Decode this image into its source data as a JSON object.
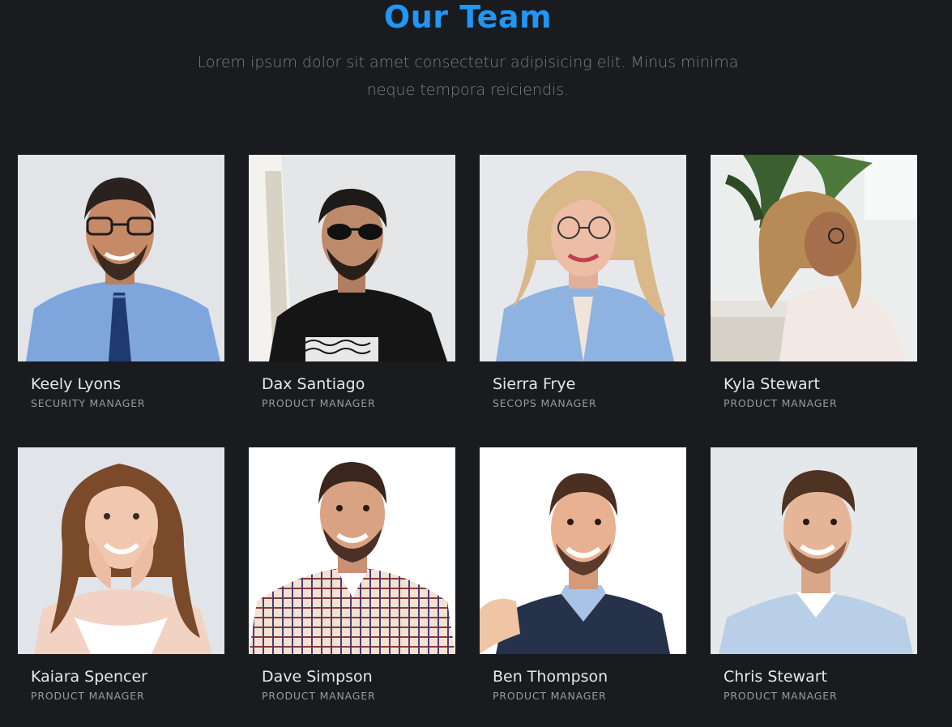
{
  "section": {
    "title": "Our Team",
    "subtitle": "Lorem ipsum dolor sit amet consectetur adipisicing elit. Minus minima neque tempora reiciendis."
  },
  "members": [
    {
      "name": "Keely Lyons",
      "role": "SECURITY MANAGER"
    },
    {
      "name": "Dax Santiago",
      "role": "PRODUCT MANAGER"
    },
    {
      "name": "Sierra Frye",
      "role": "SECOPS MANAGER"
    },
    {
      "name": "Kyla Stewart",
      "role": "PRODUCT MANAGER"
    },
    {
      "name": "Kaiara Spencer",
      "role": "PRODUCT MANAGER"
    },
    {
      "name": "Dave Simpson",
      "role": "PRODUCT MANAGER"
    },
    {
      "name": "Ben Thompson",
      "role": "PRODUCT MANAGER"
    },
    {
      "name": "Chris Stewart",
      "role": "PRODUCT MANAGER"
    }
  ],
  "colors": {
    "background": "#1a1b1e",
    "accent": "#2196f3",
    "name_text": "#e8e8e8",
    "role_text": "#9a9a9a"
  }
}
